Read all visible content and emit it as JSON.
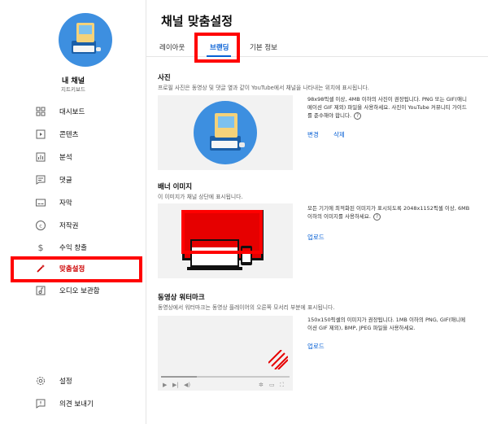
{
  "sidebar": {
    "channel_name": "내 채널",
    "channel_sub": "지트키보드",
    "items": [
      {
        "label": "대시보드",
        "icon": "dashboard-icon"
      },
      {
        "label": "콘텐츠",
        "icon": "content-icon"
      },
      {
        "label": "분석",
        "icon": "analytics-icon"
      },
      {
        "label": "댓글",
        "icon": "comments-icon"
      },
      {
        "label": "자막",
        "icon": "subtitles-icon"
      },
      {
        "label": "저작권",
        "icon": "copyright-icon"
      },
      {
        "label": "수익 창출",
        "icon": "monetization-icon"
      },
      {
        "label": "맞춤설정",
        "icon": "customization-wand-icon"
      },
      {
        "label": "오디오 보관함",
        "icon": "audio-library-icon"
      }
    ],
    "bottom_items": [
      {
        "label": "설정",
        "icon": "settings-gear-icon"
      },
      {
        "label": "의견 보내기",
        "icon": "feedback-icon"
      }
    ]
  },
  "header": {
    "title": "채널 맞춤설정",
    "tabs": [
      {
        "label": "레이아웃"
      },
      {
        "label": "브랜딩"
      },
      {
        "label": "기본 정보"
      }
    ],
    "active_tab": "브랜딩"
  },
  "picture": {
    "title": "사진",
    "desc": "프로필 사진은 동영상 및 댓글 옆과 같이 YouTube에서 채널을 나타내는 위치에 표시됩니다.",
    "hint": "98x98픽셀 이상, 4MB 이하의 사진이 권장됩니다. PNG 또는 GIF(애니메이션 GIF 제외) 파일을 사용하세요. 사진이 YouTube 커뮤니티 가이드를 준수해야 합니다.",
    "change_label": "변경",
    "delete_label": "삭제"
  },
  "banner": {
    "title": "배너 이미지",
    "desc": "이 이미지가 채널 상단에 표시됩니다.",
    "hint": "모든 기기에 최적화된 이미지가 표시되도록 2048x1152픽셀 이상, 6MB 이하의 이미지를 사용하세요.",
    "upload_label": "업로드"
  },
  "watermark": {
    "title": "동영상 워터마크",
    "desc": "동영상에서 워터마크는 동영상 플레이어의 오른쪽 모서리 부분에 표시됩니다.",
    "hint": "150x150픽셀의 이미지가 권장됩니다. 1MB 이하의 PNG, GIF(애니메이션 GIF 제외), BMP, JPEG 파일을 사용하세요.",
    "upload_label": "업로드"
  },
  "colors": {
    "accent_blue": "#065fd4",
    "highlight_red": "#ff0000",
    "active_red": "#cc0000"
  },
  "icons": {
    "help": "help-circle-icon",
    "play": "play-icon",
    "next": "skip-next-icon",
    "volume": "volume-icon",
    "settings": "settings-icon",
    "miniplayer": "miniplayer-icon",
    "fullscreen": "fullscreen-icon"
  }
}
